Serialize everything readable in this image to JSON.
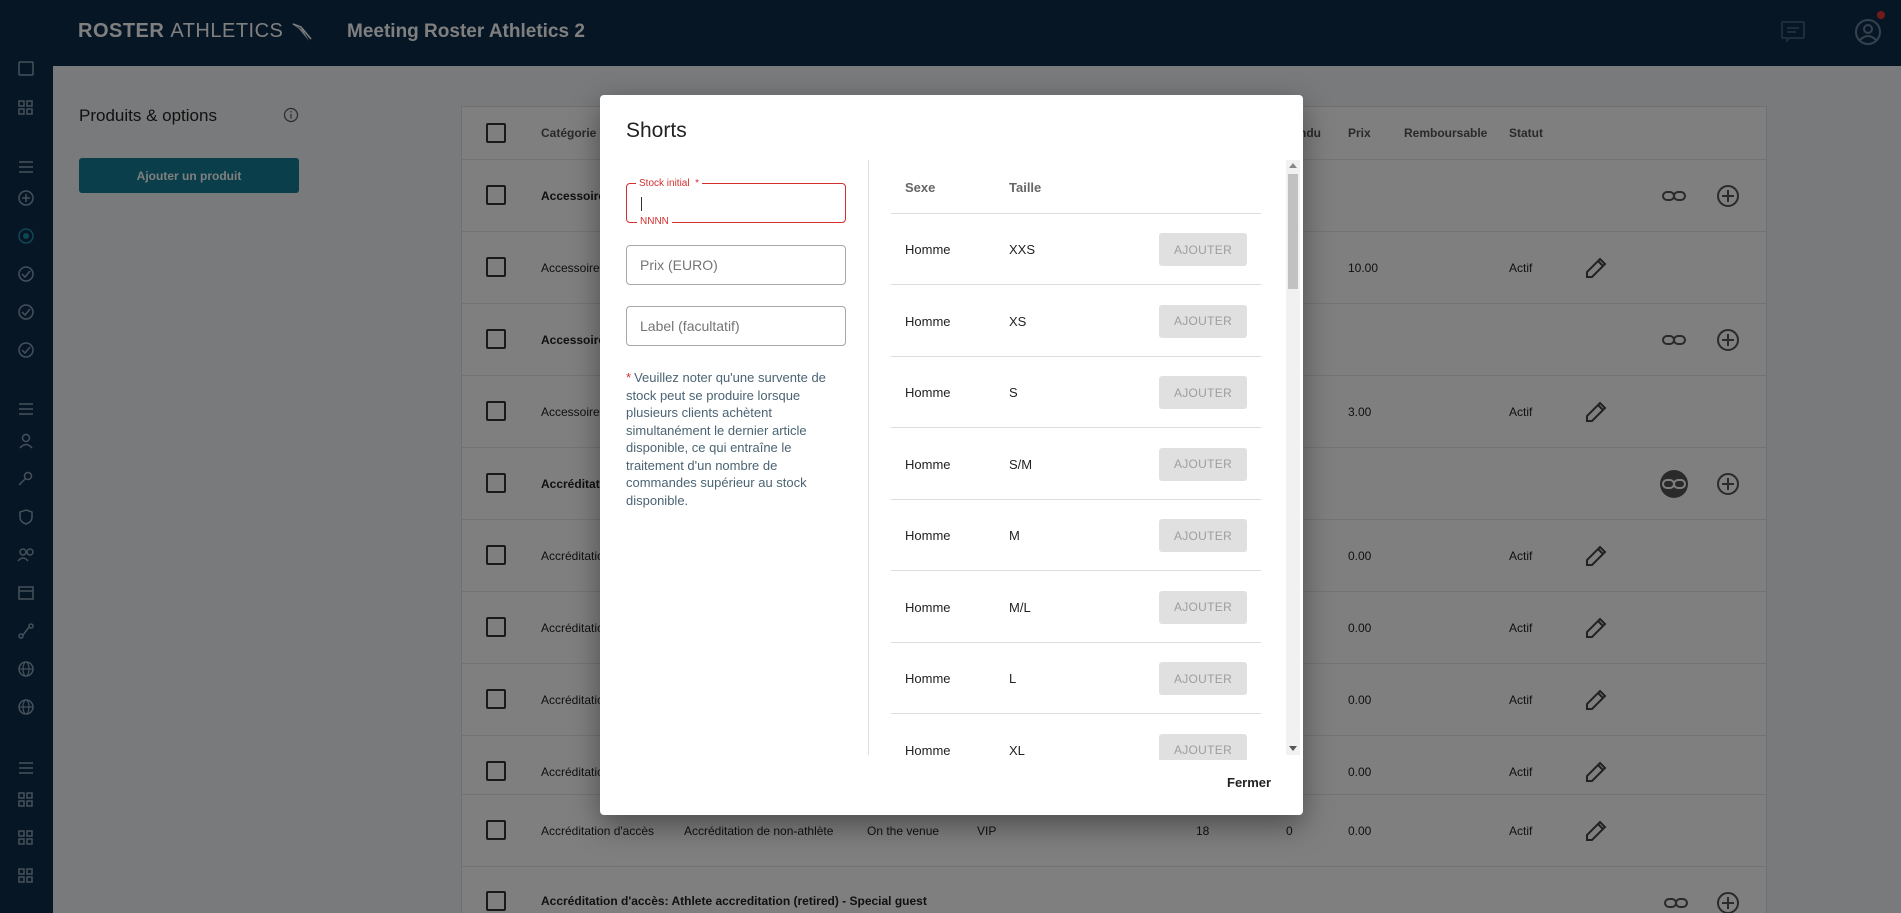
{
  "app": {
    "brand_bold": "ROSTER",
    "brand_light": "ATHLETICS",
    "meeting_title": "Meeting Roster Athletics 2"
  },
  "left_panel": {
    "title": "Produits & options",
    "add_button": "Ajouter un produit"
  },
  "table": {
    "headers": {
      "category": "Catégorie",
      "sold_partial": "ndu",
      "price": "Prix",
      "refundable": "Remboursable",
      "status": "Statut"
    },
    "rows": [
      {
        "category": "Accessoire",
        "bold": true,
        "sold": "",
        "price": "",
        "status": "",
        "actions": "link-add"
      },
      {
        "category": "Accessoire",
        "bold": false,
        "sold": "",
        "price": "10.00",
        "status": "Actif",
        "actions": "edit"
      },
      {
        "category": "Accessoire",
        "bold": true,
        "sold": "",
        "price": "",
        "status": "",
        "actions": "link-add"
      },
      {
        "category": "Accessoire",
        "bold": false,
        "sold": "",
        "price": "3.00",
        "status": "Actif",
        "actions": "edit"
      },
      {
        "category": "Accréditatio",
        "bold": true,
        "sold": "",
        "price": "",
        "status": "",
        "actions": "link-add-filled"
      },
      {
        "category": "Accréditatio",
        "bold": false,
        "sold": "",
        "price": "0.00",
        "status": "Actif",
        "actions": "edit"
      },
      {
        "category": "Accréditatio",
        "bold": false,
        "sold": "",
        "price": "0.00",
        "status": "Actif",
        "actions": "edit"
      },
      {
        "category": "Accréditatio",
        "bold": false,
        "sold": "",
        "price": "0.00",
        "status": "Actif",
        "actions": "edit"
      },
      {
        "category": "Accréditatio",
        "bold": false,
        "sold": "",
        "price": "0.00",
        "status": "Actif",
        "actions": "edit"
      }
    ],
    "row_full": {
      "category": "Accréditation d'accès",
      "type": "Accréditation de non-athlète",
      "location": "On the venue",
      "level": "VIP",
      "stock": "18",
      "sold": "0",
      "price": "0.00",
      "status": "Actif"
    },
    "row_last": {
      "label": "Accréditation d'accès: Athlete accreditation (retired) - Special guest"
    }
  },
  "modal": {
    "title": "Shorts",
    "stock_label": "Stock initial",
    "stock_required": "*",
    "stock_hint": "NNNN",
    "stock_value": "",
    "price_placeholder": "Prix (EURO)",
    "label_placeholder": "Label (facultatif)",
    "note_star": "*",
    "note": "Veuillez noter qu'une survente de stock peut se produire lorsque plusieurs clients achètent simultanément le dernier article disponible, ce qui entraîne le traitement d'un nombre de commandes supérieur au stock disponible.",
    "col_sex": "Sexe",
    "col_size": "Taille",
    "add_label": "AJOUTER",
    "sizes": [
      {
        "sex": "Homme",
        "size": "XXS"
      },
      {
        "sex": "Homme",
        "size": "XS"
      },
      {
        "sex": "Homme",
        "size": "S"
      },
      {
        "sex": "Homme",
        "size": "S/M"
      },
      {
        "sex": "Homme",
        "size": "M"
      },
      {
        "sex": "Homme",
        "size": "M/L"
      },
      {
        "sex": "Homme",
        "size": "L"
      },
      {
        "sex": "Homme",
        "size": "XL"
      }
    ],
    "close_label": "Fermer"
  },
  "colors": {
    "navy": "#0e2d4a",
    "teal": "#127d94",
    "error": "#d32f2f"
  }
}
